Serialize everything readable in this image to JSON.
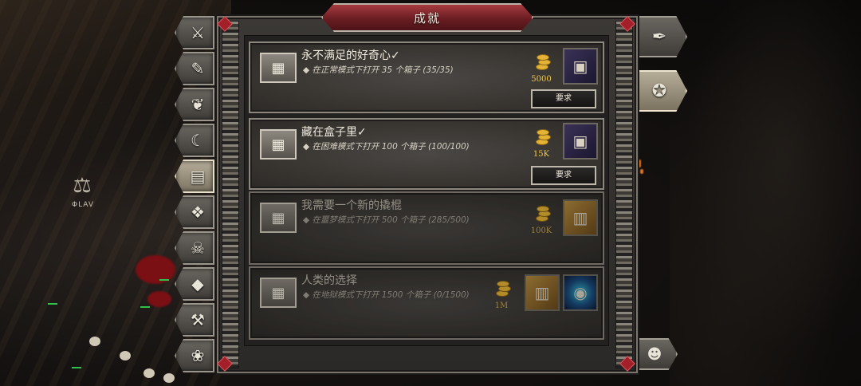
{
  "window": {
    "title": "成就"
  },
  "hud": {
    "player_name": "ΦLAV"
  },
  "left_tabs": [
    {
      "name": "tab-weapons"
    },
    {
      "name": "tab-scroll"
    },
    {
      "name": "tab-wings"
    },
    {
      "name": "tab-horn"
    },
    {
      "name": "tab-chests"
    },
    {
      "name": "tab-gems"
    },
    {
      "name": "tab-demon"
    },
    {
      "name": "tab-diamond"
    },
    {
      "name": "tab-crafting"
    },
    {
      "name": "tab-pets"
    }
  ],
  "right_tabs": [
    {
      "name": "tab-quests-feather"
    },
    {
      "name": "tab-achievements-medal"
    }
  ],
  "achievements": [
    {
      "title": "永不满足的好奇心✓",
      "desc": "◆ 在正常模式下打开 35 个箱子 (35/35)",
      "gold": "5000",
      "reward": "cube",
      "button": "要求",
      "completed": true
    },
    {
      "title": "藏在盒子里✓",
      "desc": "◆ 在困难模式下打开 100 个箱子 (100/100)",
      "gold": "15K",
      "reward": "cube",
      "button": "要求",
      "completed": true
    },
    {
      "title": "我需要一个新的撬棍",
      "desc": "◆ 在噩梦模式下打开 500 个箱子 (285/500)",
      "gold": "100K",
      "reward": "bronze-cube",
      "completed": false
    },
    {
      "title": "人类的选择",
      "desc": "◆ 在地狱模式下打开 1500 个箱子 (0/1500)",
      "gold": "1M",
      "reward": "bronze-cube",
      "reward2": "portal-amulet",
      "completed": false
    }
  ],
  "colors": {
    "title_red": "#8a2a30",
    "gold": "#f0c84a",
    "frame": "#8c877e"
  }
}
